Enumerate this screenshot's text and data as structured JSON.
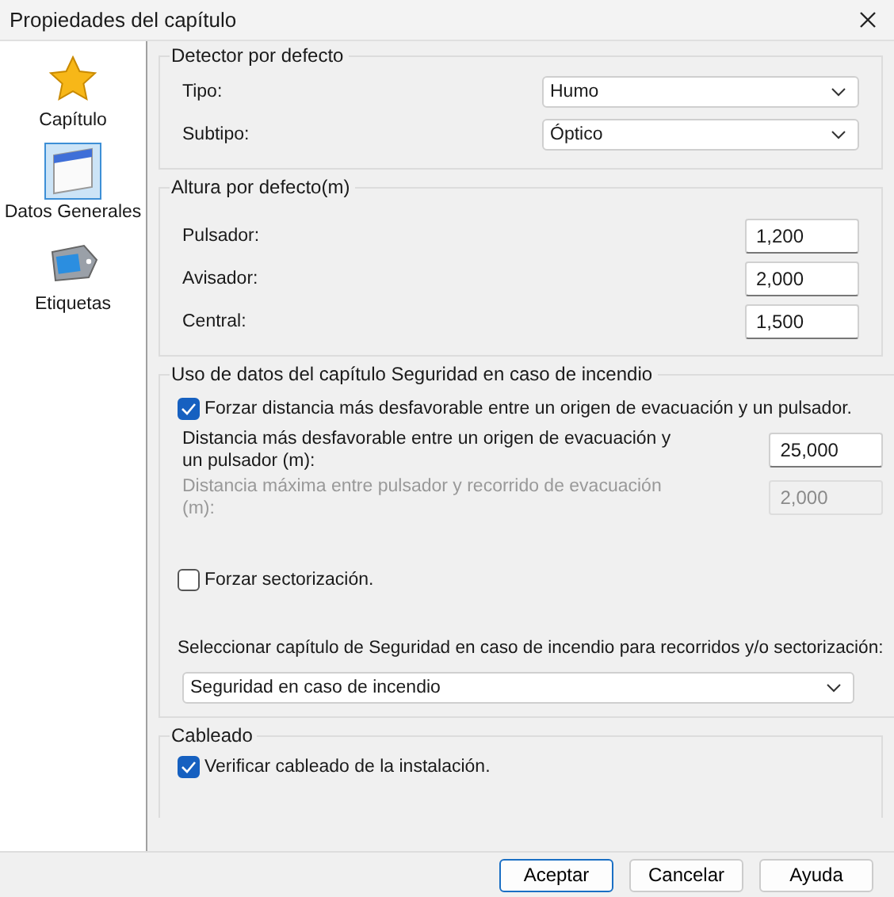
{
  "window": {
    "title": "Propiedades del capítulo"
  },
  "sidebar": {
    "items": [
      {
        "label": "Capítulo",
        "selected": false
      },
      {
        "label": "Datos Generales",
        "selected": true
      },
      {
        "label": "Etiquetas",
        "selected": false
      }
    ]
  },
  "detector": {
    "title": "Detector por defecto",
    "fields": [
      {
        "label": "Tipo:",
        "value": "Humo"
      },
      {
        "label": "Subtipo:",
        "value": "Óptico"
      }
    ]
  },
  "altura": {
    "title": "Altura por defecto(m)",
    "fields": [
      {
        "label": "Pulsador:",
        "value": "1,200"
      },
      {
        "label": "Avisador:",
        "value": "2,000"
      },
      {
        "label": "Central:",
        "value": "1,500"
      }
    ]
  },
  "uso": {
    "title": "Uso de datos del capítulo Seguridad en caso de incendio",
    "force_distance": {
      "label": "Forzar distancia más desfavorable entre un origen de evacuación y un pulsador.",
      "checked": true
    },
    "distance": {
      "label": "Distancia más desfavorable entre un origen de evacuación y un pulsador (m):",
      "value": "25,000",
      "disabled": false
    },
    "max_distance": {
      "label": "Distancia máxima entre pulsador y recorrido de evacuación (m):",
      "value": "2,000",
      "disabled": true
    },
    "force_sector": {
      "label": "Forzar sectorización.",
      "checked": false
    },
    "select_label": "Seleccionar capítulo de Seguridad en caso de incendio para recorridos y/o sectorización:",
    "select_value": "Seguridad en caso de incendio"
  },
  "cableado": {
    "title": "Cableado",
    "verify": {
      "label": "Verificar cableado de la instalación.",
      "checked": true
    }
  },
  "buttons": [
    {
      "label": "Aceptar",
      "default": true
    },
    {
      "label": "Cancelar",
      "default": false
    },
    {
      "label": "Ayuda",
      "default": false
    }
  ]
}
